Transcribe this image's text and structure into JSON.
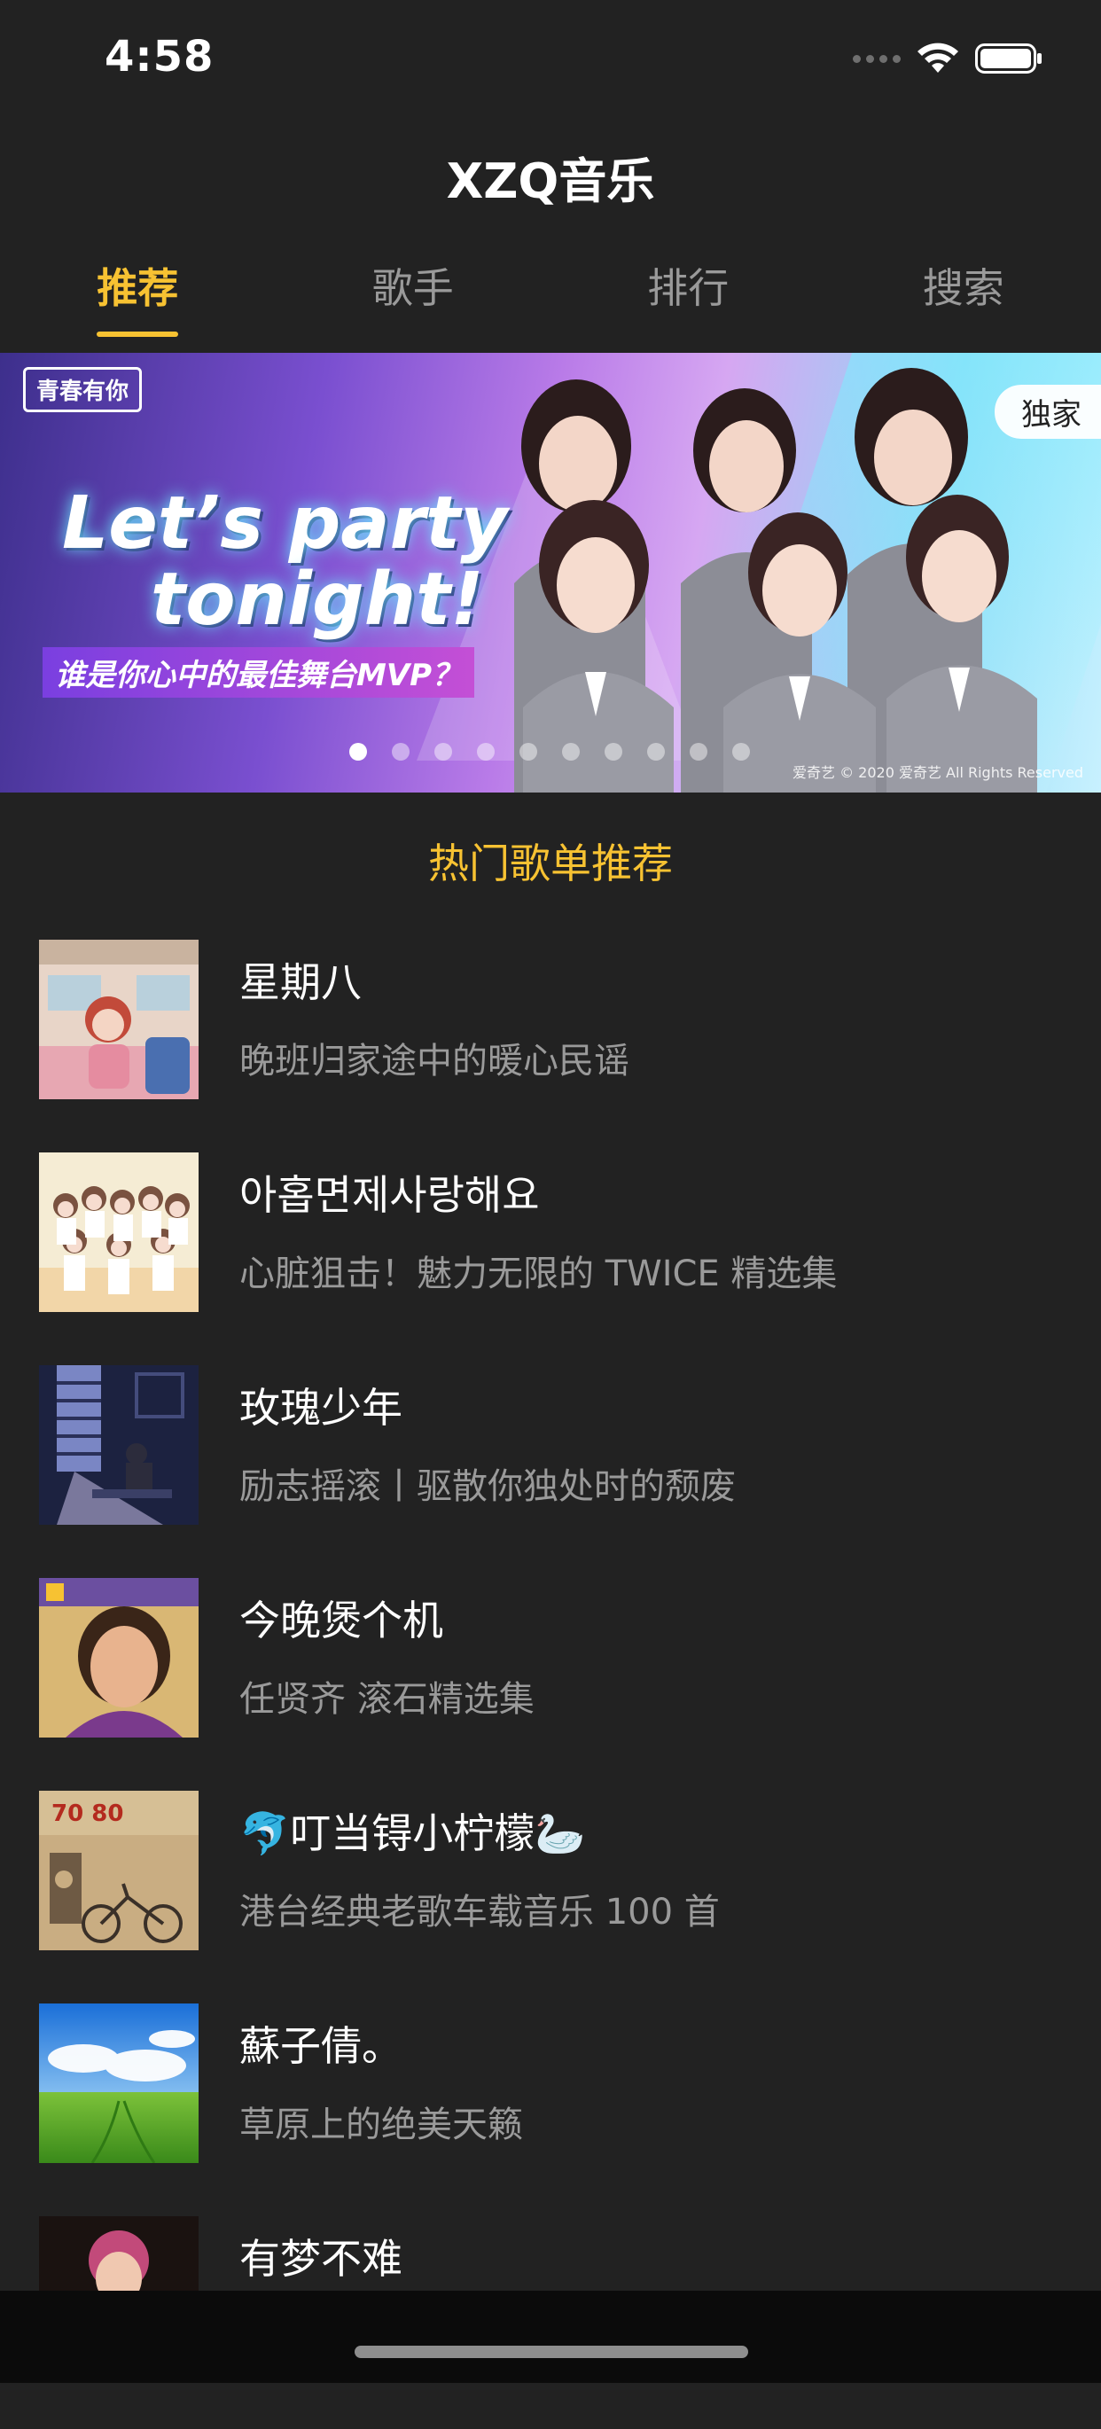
{
  "status_bar": {
    "time": "4:58",
    "icons": [
      "signal-icon",
      "wifi-icon",
      "battery-icon"
    ]
  },
  "app": {
    "title": "XZQ音乐"
  },
  "tabs": [
    {
      "label": "推荐",
      "active": true
    },
    {
      "label": "歌手",
      "active": false
    },
    {
      "label": "排行",
      "active": false
    },
    {
      "label": "搜索",
      "active": false
    }
  ],
  "banner": {
    "logo_text": "青春有你",
    "headline_line1": "Let’s party",
    "headline_line2": "tonight!",
    "subline": "谁是你心中的最佳舞台MVP？",
    "badge": "独家",
    "copyright": "爱奇艺 © 2020 爱奇艺 All Rights Reserved",
    "page_count": 10,
    "active_page": 1
  },
  "section": {
    "title": "热门歌单推荐"
  },
  "playlists": [
    {
      "title": "星期八",
      "desc": "晚班归家途中的暖心民谣"
    },
    {
      "title": "아홉면제사랑해요",
      "desc": "心脏狙击！魅力无限的 TWICE 精选集"
    },
    {
      "title": "玫瑰少年",
      "desc": "励志摇滚丨驱散你独处时的颓废"
    },
    {
      "title": "今晚煲个机",
      "desc": "任贤齐 滚石精选集"
    },
    {
      "title": "🐬叮当锝小柠檬🦢",
      "desc": "港台经典老歌车载音乐 100 首"
    },
    {
      "title": "蘇子倩。",
      "desc": "草原上的绝美天籁"
    },
    {
      "title": "有梦不难",
      "desc": ""
    }
  ],
  "colors": {
    "background": "#222222",
    "accent": "#f7c232",
    "secondary_text": "#9a9a9a"
  }
}
